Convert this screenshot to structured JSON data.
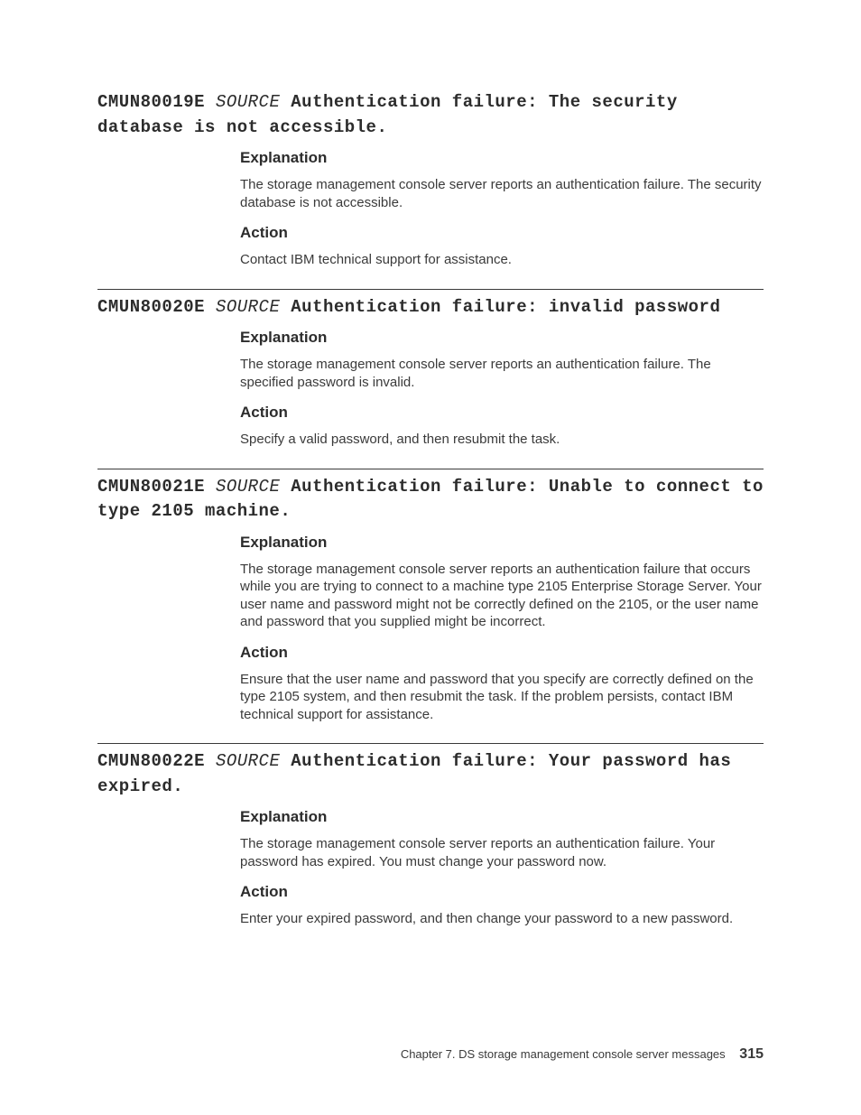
{
  "entries": [
    {
      "code": "CMUN80019E",
      "source": "SOURCE",
      "title": "Authentication failure: The security database is not accessible.",
      "explanation_label": "Explanation",
      "explanation": "The storage management console server reports an authentication failure. The security database is not accessible.",
      "action_label": "Action",
      "action": "Contact IBM technical support for assistance."
    },
    {
      "code": "CMUN80020E",
      "source": "SOURCE",
      "title": "Authentication failure: invalid password",
      "explanation_label": "Explanation",
      "explanation": "The storage management console server reports an authentication failure. The specified password is invalid.",
      "action_label": "Action",
      "action": "Specify a valid password, and then resubmit the task."
    },
    {
      "code": "CMUN80021E",
      "source": "SOURCE",
      "title": "Authentication failure: Unable to connect to type 2105 machine.",
      "explanation_label": "Explanation",
      "explanation": "The storage management console server reports an authentication failure that occurs while you are trying to connect to a machine type 2105 Enterprise Storage Server. Your user name and password might not be correctly defined on the 2105, or the user name and password that you supplied might be incorrect.",
      "action_label": "Action",
      "action": "Ensure that the user name and password that you specify are correctly defined on the type 2105 system, and then resubmit the task. If the problem persists, contact IBM technical support for assistance."
    },
    {
      "code": "CMUN80022E",
      "source": "SOURCE",
      "title": "Authentication failure: Your password has expired.",
      "explanation_label": "Explanation",
      "explanation": "The storage management console server reports an authentication failure. Your password has expired. You must change your password now.",
      "action_label": "Action",
      "action": "Enter your expired password, and then change your password to a new password."
    }
  ],
  "footer": {
    "chapter": "Chapter 7. DS storage management console server messages",
    "page": "315"
  }
}
